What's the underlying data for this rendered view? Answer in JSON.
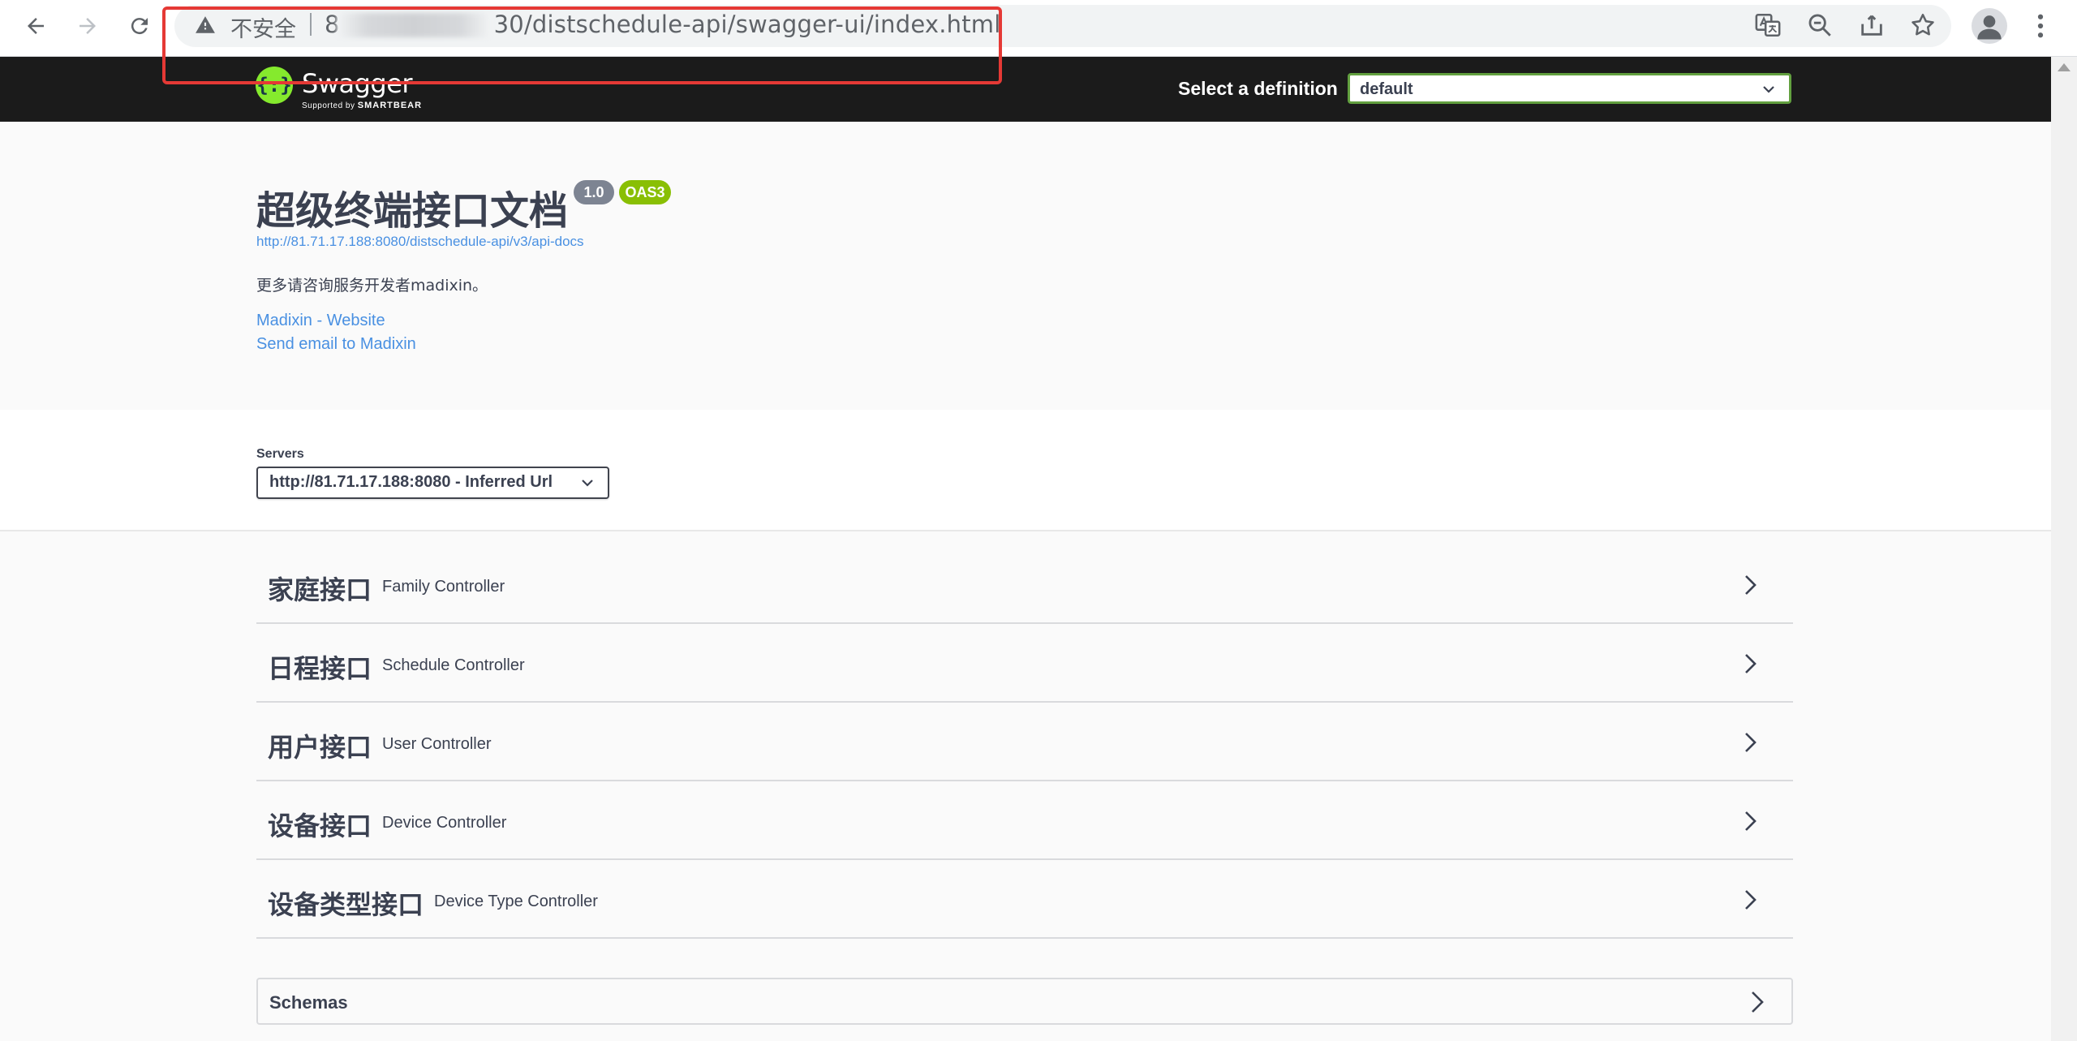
{
  "browser": {
    "security_label": "不安全",
    "url_prefix": "8",
    "url_suffix": "30/distschedule-api/swagger-ui/index.html"
  },
  "topbar": {
    "logo_text": "Swagger",
    "logo_sub_prefix": "Supported by",
    "logo_sub_brand": "SMARTBEAR",
    "definition_label": "Select a definition",
    "definition_value": "default"
  },
  "info": {
    "title": "超级终端接口文档",
    "version": "1.0",
    "oas": "OAS3",
    "api_docs_url": "http://81.71.17.188:8080/distschedule-api/v3/api-docs",
    "description": "更多请咨询服务开发者madixin。",
    "website_link": "Madixin - Website",
    "email_link": "Send email to Madixin"
  },
  "servers": {
    "label": "Servers",
    "selected": "http://81.71.17.188:8080 - Inferred Url"
  },
  "tags": [
    {
      "name": "家庭接口",
      "description": "Family Controller"
    },
    {
      "name": "日程接口",
      "description": "Schedule Controller"
    },
    {
      "name": "用户接口",
      "description": "User Controller"
    },
    {
      "name": "设备接口",
      "description": "Device Controller"
    },
    {
      "name": "设备类型接口",
      "description": "Device Type Controller"
    }
  ],
  "schemas": {
    "label": "Schemas"
  },
  "colors": {
    "accent_green": "#85ea2d",
    "topbar_bg": "#1b1b1b",
    "link_blue": "#4990e2",
    "highlight_red": "#e53935"
  }
}
